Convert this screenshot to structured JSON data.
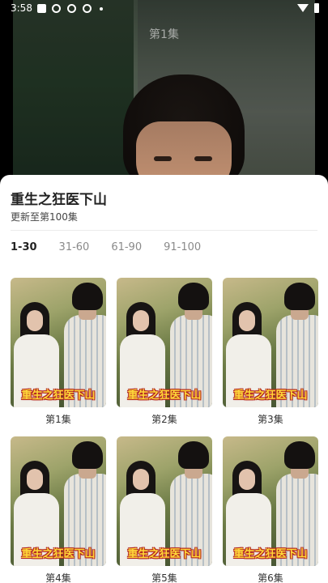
{
  "status": {
    "time": "3:58"
  },
  "video": {
    "watermark": "第1集"
  },
  "sheet": {
    "title": "重生之狂医下山",
    "update": "更新至第100集",
    "tabs": [
      {
        "label": "1-30",
        "active": true
      },
      {
        "label": "31-60",
        "active": false
      },
      {
        "label": "61-90",
        "active": false
      },
      {
        "label": "91-100",
        "active": false
      }
    ],
    "poster_title": "重生之狂医下山",
    "episodes": [
      {
        "label": "第1集"
      },
      {
        "label": "第2集"
      },
      {
        "label": "第3集"
      },
      {
        "label": "第4集"
      },
      {
        "label": "第5集"
      },
      {
        "label": "第6集"
      }
    ]
  }
}
